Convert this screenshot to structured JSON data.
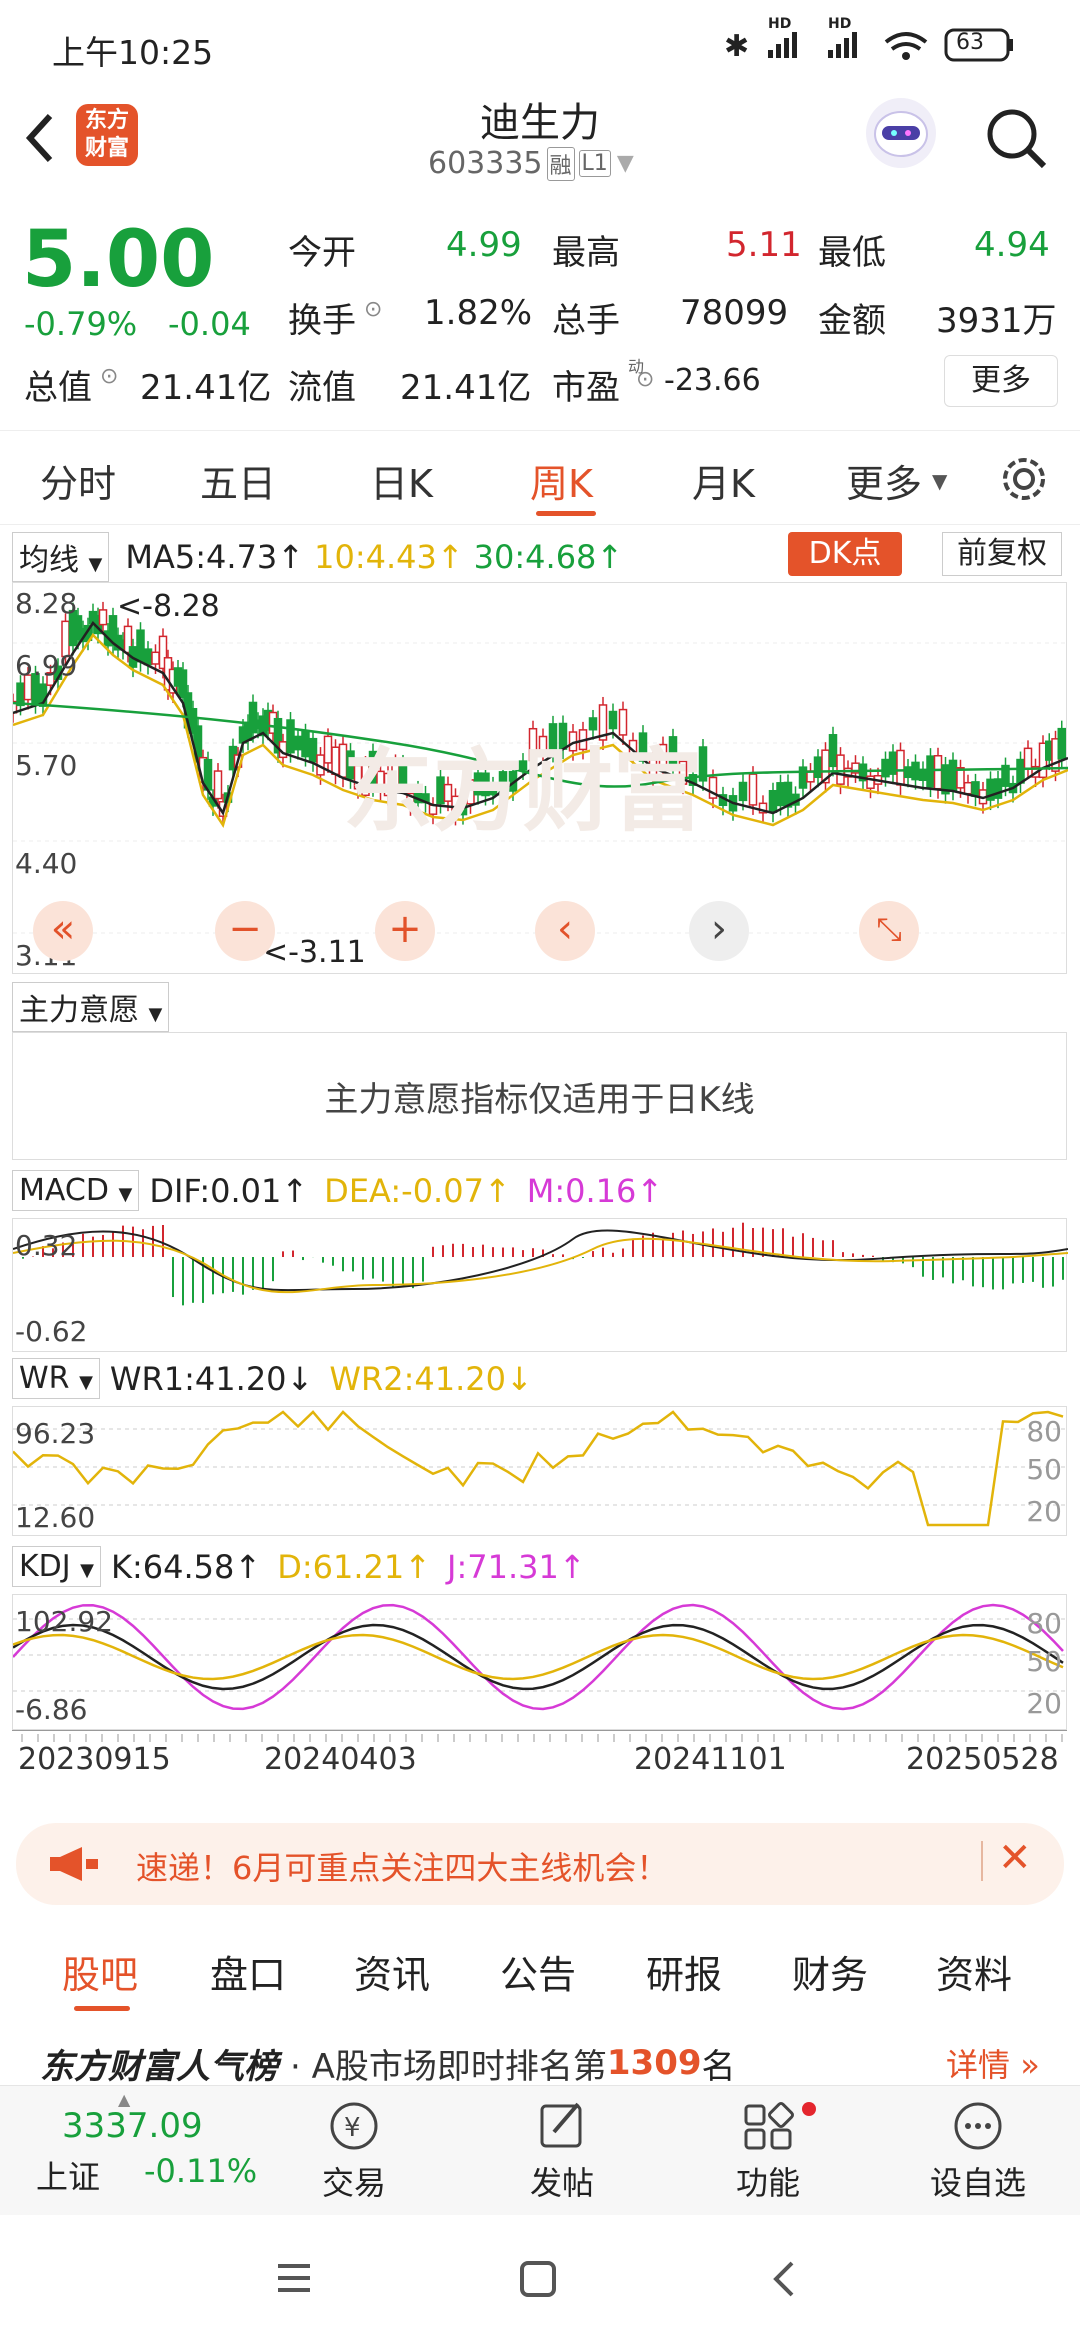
{
  "status": {
    "time": "上午10:25",
    "battery": "63",
    "hd1": "HD",
    "hd2": "HD"
  },
  "header": {
    "logo": "东方\n财富",
    "name": "迪生力",
    "code": "603335",
    "badge_rong": "融",
    "badge_l1": "L1"
  },
  "quote": {
    "price": "5.00",
    "change_pct": "-0.79%",
    "change": "-0.04",
    "open_label": "今开",
    "open": "4.99",
    "high_label": "最高",
    "high": "5.11",
    "low_label": "最低",
    "low": "4.94",
    "turnover_label": "换手",
    "turnover": "1.82%",
    "volume_label": "总手",
    "volume": "78099",
    "amount_label": "金额",
    "amount": "3931万",
    "total_value_label": "总值",
    "total_value": "21.41亿",
    "float_value_label": "流值",
    "float_value": "21.41亿",
    "pe_label": "市盈",
    "pe_sup": "动",
    "pe": "-23.66",
    "more_button": "更多"
  },
  "tabs": [
    "分时",
    "五日",
    "日K",
    "周K",
    "月K",
    "更多"
  ],
  "active_tab": "周K",
  "kline": {
    "selector": "均线",
    "ma5": "MA5:4.73",
    "ma10": "10:4.43",
    "ma30": "30:4.68",
    "dk_button": "DK点",
    "adjust_button": "前复权",
    "y_ticks": [
      "8.28",
      "6.99",
      "5.70",
      "4.40",
      "3.11"
    ],
    "max_label": "<-8.28",
    "min_label": "<-3.11",
    "watermark": "东方财富",
    "colors": {
      "up": "#d2262e",
      "down": "#18a03c",
      "ma5": "#222222",
      "ma10": "#e2b40a",
      "ma30": "#18a03c"
    }
  },
  "main_force": {
    "selector": "主力意愿",
    "message": "主力意愿指标仅适用于日K线"
  },
  "macd": {
    "selector": "MACD",
    "dif": "DIF:0.01",
    "dea": "DEA:-0.07",
    "m": "M:0.16",
    "y_top": "0.32",
    "y_bottom": "-0.62"
  },
  "wr": {
    "selector": "WR",
    "wr1": "WR1:41.20",
    "wr2": "WR2:41.20",
    "y_top": "96.23",
    "y_bottom": "12.60",
    "levels": [
      "80",
      "50",
      "20"
    ]
  },
  "kdj": {
    "selector": "KDJ",
    "k": "K:64.58",
    "d": "D:61.21",
    "j": "J:71.31",
    "y_top": "102.92",
    "y_bottom": "-6.86",
    "levels": [
      "80",
      "50",
      "20"
    ]
  },
  "dates": [
    "20230915",
    "20240403",
    "20241101",
    "20250528"
  ],
  "ticker": {
    "text": "速递！6月可重点关注四大主线机会！"
  },
  "subtabs": [
    "股吧",
    "盘口",
    "资讯",
    "公告",
    "研报",
    "财务",
    "资料"
  ],
  "active_subtab": "股吧",
  "rank": {
    "brand": "东方财富人气榜",
    "text_prefix": "· A股市场即时排名第",
    "rank": "1309",
    "text_suffix": "名",
    "detail": "详情"
  },
  "bottom_nav": {
    "index_value": "3337.09",
    "index_name": "上证",
    "index_change": "-0.11%",
    "items": [
      "交易",
      "发帖",
      "功能",
      "设自选"
    ]
  }
}
